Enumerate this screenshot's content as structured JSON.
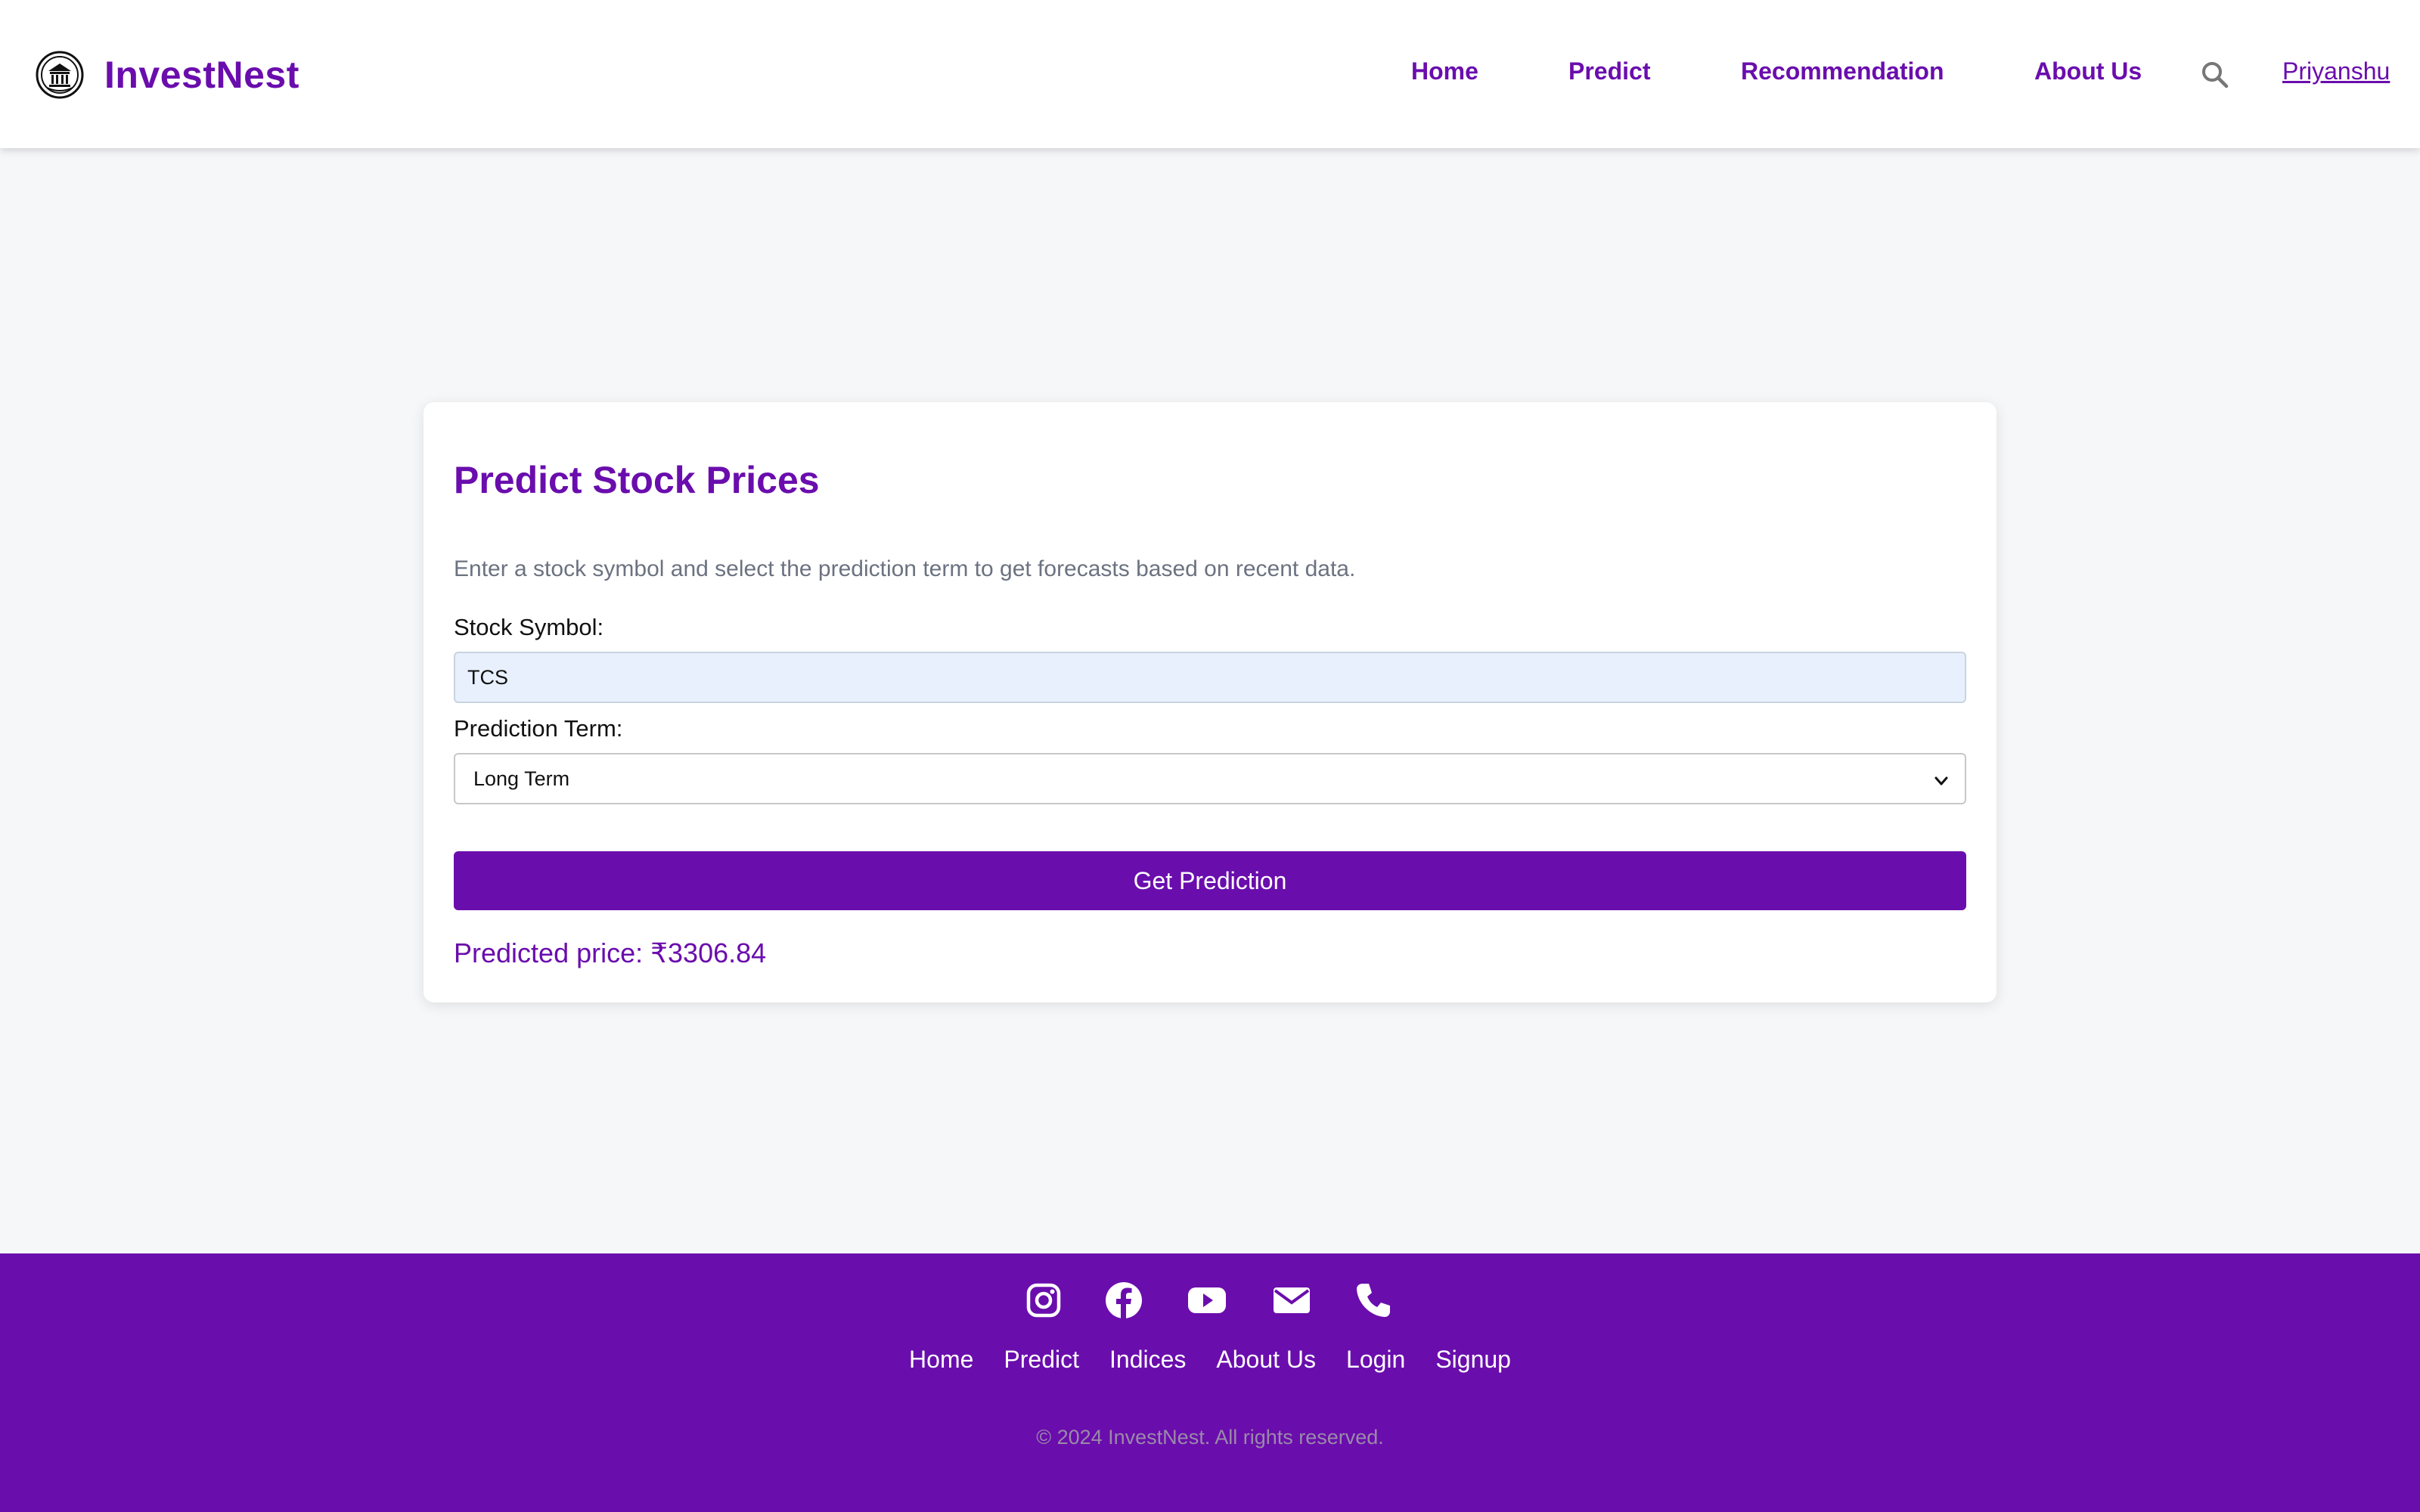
{
  "header": {
    "brand": "InvestNest",
    "logo_icon": "bank-building-icon",
    "nav": [
      "Home",
      "Predict",
      "Recommendation",
      "About Us"
    ],
    "search_icon": "search-icon",
    "user": "Priyanshu"
  },
  "form": {
    "title": "Predict Stock Prices",
    "description": "Enter a stock symbol and select the prediction term to get forecasts based on recent data.",
    "symbol_label": "Stock Symbol:",
    "symbol_value": "TCS",
    "term_label": "Prediction Term:",
    "term_value": "Long Term",
    "submit_label": "Get Prediction",
    "result": "Predicted price: ₹3306.84"
  },
  "footer": {
    "social_icons": [
      "instagram-icon",
      "facebook-icon",
      "youtube-icon",
      "mail-icon",
      "phone-icon"
    ],
    "links": [
      "Home",
      "Predict",
      "Indices",
      "About Us",
      "Login",
      "Signup"
    ],
    "copyright": "© 2024 InvestNest. All rights reserved."
  },
  "colors": {
    "brand": "#6a0dad",
    "background": "#f6f7f9",
    "input_fill": "#e8f0fd"
  }
}
